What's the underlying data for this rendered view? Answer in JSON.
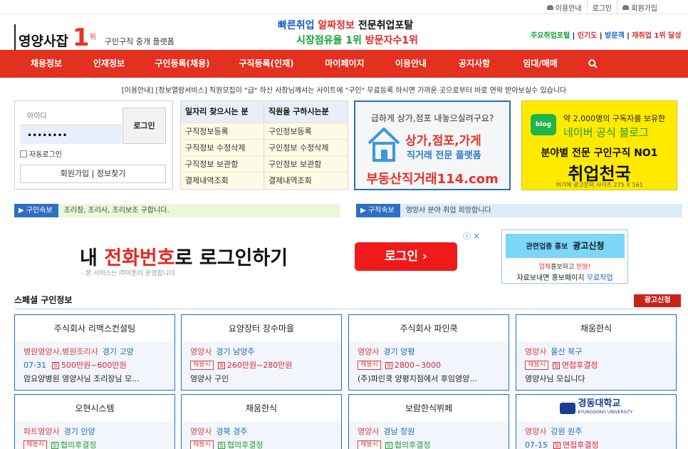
{
  "top_links": [
    "이용안내",
    "로그인",
    "회원가입"
  ],
  "logo": {
    "name": "영양사잡",
    "rank": "1",
    "rank_suffix": "위",
    "tagline": "구인구직 중개 플랫폼"
  },
  "slogan": {
    "line1": [
      {
        "t": "빠른취업 ",
        "c": "blue"
      },
      {
        "t": "알짜정보 ",
        "c": "red"
      },
      {
        "t": "전문취업포탈",
        "c": "black"
      }
    ],
    "line2": [
      {
        "t": "시장점유율 1위 ",
        "c": "green"
      },
      {
        "t": "방문자수1위",
        "c": "red"
      }
    ]
  },
  "right_note": [
    {
      "t": "주요취업포털",
      "c": "green"
    },
    {
      "t": " | ",
      "c": "black"
    },
    {
      "t": "인기도",
      "c": "red"
    },
    {
      "t": " | ",
      "c": "black"
    },
    {
      "t": "방문객",
      "c": "blue"
    },
    {
      "t": " | ",
      "c": "black"
    },
    {
      "t": "재취업 1위 달성",
      "c": "red"
    }
  ],
  "nav": [
    "채용정보",
    "인재정보",
    "구인등록(채용)",
    "구직등록(인재)",
    "마이페이지",
    "이용안내",
    "공지사항",
    "임대/매매"
  ],
  "notice": "[이용안내] [정보열람서비스] 직원모집이 \"급\" 하신 사장님께서는 사이트에 \"구인\" 무료등록 하시면 가까운 곳으로부터 바로 연락 받아보실수 있습니다",
  "login": {
    "id_placeholder": "아이디",
    "password_value": "••••••••",
    "button": "로그인",
    "auto_login": "자동로그인",
    "join": "회원가입",
    "find": "정보찾기"
  },
  "services": {
    "seeker": {
      "title": "일자리 찾으시는 분",
      "items": [
        "구직정보등록",
        "구직정보 수정삭제",
        "구직정보 보관함",
        "결제내역조회"
      ]
    },
    "employer": {
      "title": "직원을 구하시는분",
      "items": [
        "구인정보등록",
        "구인정보 수정삭제",
        "구인정보 보관함",
        "결제내역조회"
      ]
    }
  },
  "ad_realestate": {
    "line1": "급하게 상가,점포 내놓으실려구요?",
    "line2": "상가,점포,가게",
    "line3": "직거래 전문 플랫폼",
    "line4": "부동산직거래114.com"
  },
  "ad_blog": {
    "badge": "blog",
    "line1": "약 2,000명의 구독자를 보유한",
    "line2": "네이버 공식 블로그",
    "line3": "분야별 전문 구인구직 NO1",
    "line4": "취업천국",
    "footer": "여기에 광고문의 사이즈 275 X 161"
  },
  "marquee": [
    {
      "tag": "구인속보",
      "text": "조리장, 조리사, 조리보조 구합니다."
    },
    {
      "tag": "구직속보",
      "text": "영양사 분야 취업 희망합니다"
    }
  ],
  "kakao_banner": {
    "pre": "내 ",
    "highlight": "전화번호",
    "post": "로 로그인하기",
    "small": "- 본 서비스는 ㈜아톤이 운영합니다.",
    "button": "로그인"
  },
  "ad_promo": {
    "title": "관련업종 홍보",
    "title2": "광고신청",
    "l1a": "업체",
    "l1b": "홍보하고 ",
    "l1c": "만땅!",
    "l2a": "자료보내면 홍보페이지 ",
    "l2b": "무료작업"
  },
  "special": {
    "title": "스페셜 구인정보",
    "ad_button": "광고신청"
  },
  "cards_row1": [
    {
      "name": "주식회사 리맥스컨설팅",
      "job": "병원영양사,병원조리사",
      "loc": "경기 고양",
      "date": "07-31",
      "pay_icon": "월",
      "pay": "500만원~600만원",
      "pay_color": "red",
      "desc": "암요양병원 영양사님 조리장님 모..."
    },
    {
      "name": "요양장터 장수마을",
      "job": "영양사",
      "loc": "경기 남양주",
      "date": "",
      "tag": "채용시",
      "pay_icon": "월",
      "pay": "260만원~280만원",
      "pay_color": "red",
      "desc": "영양사 구인"
    },
    {
      "name": "주식회사 파인쿡",
      "job": "영양사",
      "loc": "경기 양평",
      "date": "",
      "tag": "채용시",
      "pay_icon": "월",
      "pay": "2800~3000",
      "pay_color": "red",
      "desc": "(주)파인쿡 양평지점에서 후임영양..."
    },
    {
      "name": "채움한식",
      "job": "영양사",
      "loc": "울산 북구",
      "date": "",
      "tag": "채용시",
      "pay_icon": "협",
      "pay": "면접후결정",
      "pay_color": "red",
      "desc": "영양사님 모십니다"
    }
  ],
  "cards_row2": [
    {
      "name": "오현시스템",
      "job": "파트영양사",
      "loc": "경기 안양",
      "date": "",
      "tag": "채용시",
      "pay_icon": "협",
      "pay": "협의후결정",
      "pay_color": "green"
    },
    {
      "name": "채움한식",
      "job": "영양사",
      "loc": "경북 경주",
      "date": "",
      "tag": "채용시",
      "pay_icon": "협",
      "pay": "협의후결정",
      "pay_color": "green"
    },
    {
      "name": "보람한식뷔페",
      "job": "영양사",
      "loc": "경남 창원",
      "date": "",
      "tag": "채용시",
      "pay_icon": "협",
      "pay": "협의후결정",
      "pay_color": "green"
    },
    {
      "name": "",
      "logo_text": "경동대학교",
      "logo_sub": "KYUNGDONG UNIVERSITY",
      "job": "영양사",
      "loc": "강원 원주",
      "date": "07-15",
      "pay_icon": "협",
      "pay": "면접후결정",
      "pay_color": "red"
    }
  ]
}
